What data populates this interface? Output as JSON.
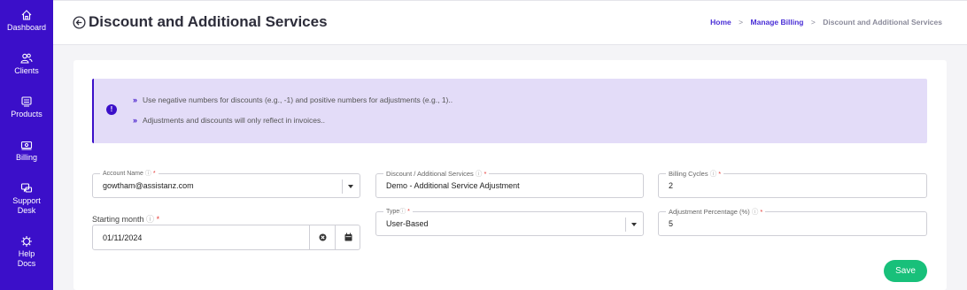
{
  "sidebar": {
    "items": [
      {
        "label": "Dashboard",
        "icon": "home-icon"
      },
      {
        "label": "Clients",
        "icon": "users-icon"
      },
      {
        "label": "Products",
        "icon": "products-icon"
      },
      {
        "label": "Billing",
        "icon": "billing-icon"
      },
      {
        "label": "Support Desk",
        "label_line1": "Support",
        "label_line2": "Desk",
        "icon": "support-icon"
      },
      {
        "label": "Help Docs",
        "label_line1": "Help",
        "label_line2": "Docs",
        "icon": "help-icon"
      }
    ]
  },
  "header": {
    "title": "Discount and Additional Services",
    "breadcrumb": {
      "home": "Home",
      "sep": ">",
      "billing": "Manage Billing",
      "current": "Discount and Additional Services"
    }
  },
  "info": {
    "line1": "Use negative numbers for discounts (e.g., -1) and positive numbers for adjustments (e.g., 1)..",
    "line2": "Adjustments and discounts will only reflect in invoices..",
    "chevron": "»",
    "icon_glyph": "!"
  },
  "form": {
    "account_name": {
      "label": "Account Name",
      "value": "gowtham@assistanz.com"
    },
    "discount_service": {
      "label": "Discount / Additional Services",
      "value": "Demo - Additional Service Adjustment"
    },
    "billing_cycles": {
      "label": "Billing Cycles",
      "value": "2"
    },
    "starting_month": {
      "label": "Starting month",
      "value": "01/11/2024"
    },
    "type": {
      "label": "Type",
      "value": "User-Based"
    },
    "adjustment_percentage": {
      "label": "Adjustment Percentage (%)",
      "value": "5"
    },
    "required_mark": "*",
    "help_mark": "ⓘ"
  },
  "actions": {
    "save_label": "Save"
  },
  "colors": {
    "primary": "#3b0fc9",
    "save": "#18c07a",
    "info_bg": "#e3dcf8"
  }
}
